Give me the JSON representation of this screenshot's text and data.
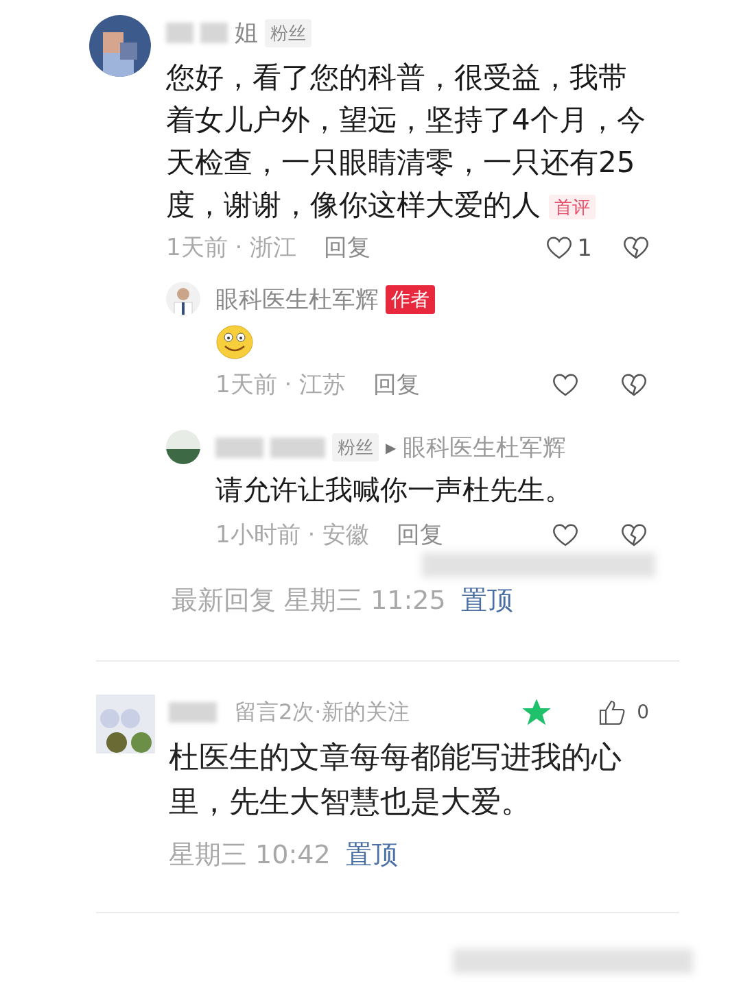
{
  "comment": {
    "name": "姐",
    "badge": "粉丝",
    "body": "您好，看了您的科普，很受益，我带着女儿户外，望远，坚持了4个月，今天检查，一只眼睛清零，一只还有25度，谢谢，像你这样大爱的人",
    "tag": "首评",
    "time": "1天前 · 浙江",
    "reply": "回复",
    "likes": "1",
    "replies": [
      {
        "kind": "author",
        "name": "眼科医生杜军辉",
        "badge": "作者",
        "time": "1天前 · 江苏",
        "reply": "回复"
      },
      {
        "kind": "fan",
        "badge": "粉丝",
        "arrow": "▶",
        "to": "眼科医生杜军辉",
        "body": "请允许让我喊你一声杜先生。",
        "time": "1小时前 · 安徽",
        "reply": "回复"
      }
    ],
    "latest": "最新回复 星期三 11:25",
    "pin": "置顶"
  },
  "message": {
    "info": "留言2次·新的关注",
    "featured": true,
    "likes": "0",
    "body": "杜医生的文章每每都能写进我的心里，先生大智慧也是大爱。",
    "time": "星期三 10:42",
    "pin": "置顶"
  }
}
